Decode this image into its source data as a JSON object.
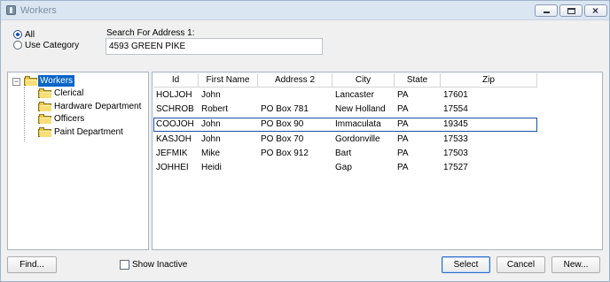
{
  "window": {
    "title": "Workers"
  },
  "filter": {
    "all_label": "All",
    "category_label": "Use Category"
  },
  "search": {
    "label": "Search For Address 1:",
    "value": "4593 GREEN PIKE"
  },
  "tree": {
    "root": "Workers",
    "children": [
      "Clerical",
      "Hardware Department",
      "Officers",
      "Paint Department"
    ]
  },
  "table": {
    "columns": [
      "Id",
      "First Name",
      "Address 2",
      "City",
      "State",
      "Zip"
    ],
    "rows": [
      [
        "HOLJOH",
        "John",
        "",
        "Lancaster",
        "PA",
        "17601"
      ],
      [
        "SCHROB",
        "Robert",
        "PO Box 781",
        "New Holland",
        "PA",
        "17554"
      ],
      [
        "COOJOH",
        "John",
        "PO Box 90",
        "Immaculata",
        "PA",
        "19345"
      ],
      [
        "KASJOH",
        "John",
        "PO Box 70",
        "Gordonville",
        "PA",
        "17533"
      ],
      [
        "JEFMIK",
        "Mike",
        "PO Box 912",
        "Bart",
        "PA",
        "17503"
      ],
      [
        "JOHHEI",
        "Heidi",
        "",
        "Gap",
        "PA",
        "17527"
      ]
    ],
    "selected_index": 2
  },
  "footer": {
    "find_label": "Find...",
    "show_inactive_label": "Show Inactive",
    "select_label": "Select",
    "cancel_label": "Cancel",
    "new_label": "New..."
  },
  "colors": {
    "selection": "#0a64c8",
    "accent": "#1f4fa3"
  }
}
